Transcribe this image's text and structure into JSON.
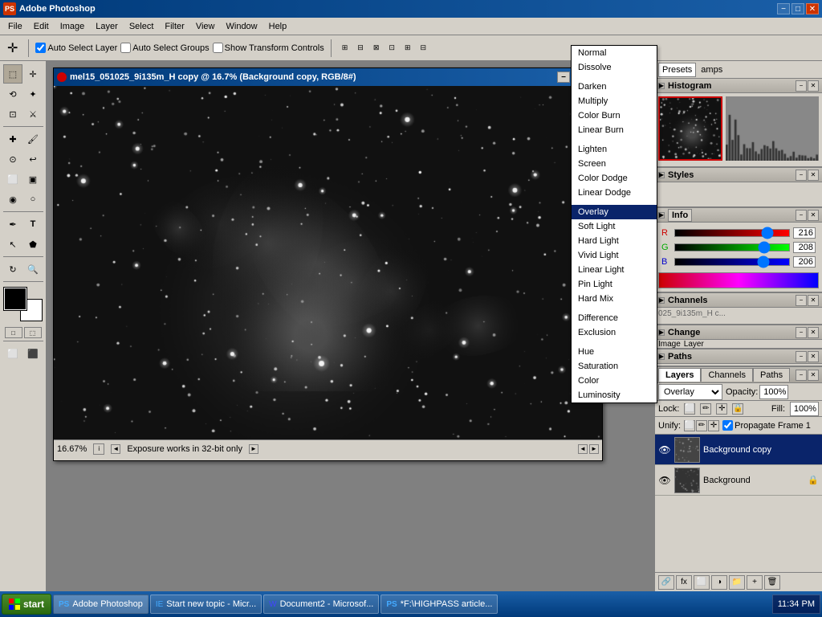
{
  "app": {
    "title": "Adobe Photoshop",
    "icon": "PS"
  },
  "titlebar": {
    "title": "Adobe Photoshop",
    "minimize": "−",
    "maximize": "□",
    "close": "✕"
  },
  "menubar": {
    "items": [
      "File",
      "Edit",
      "Image",
      "Layer",
      "Select",
      "Filter",
      "View",
      "Window",
      "Help"
    ]
  },
  "toolbar": {
    "select_label": "Select",
    "auto_select_layer": "Auto Select Layer",
    "auto_select_groups": "Auto Select Groups",
    "show_transform": "Show Transform Controls"
  },
  "document": {
    "title": "mel15_051025_9i135m_H copy @ 16.7% (Background copy, RGB/8#)",
    "zoom": "16.67%",
    "status": "Exposure works in 32-bit only"
  },
  "blend_modes": {
    "current": "Overlay",
    "groups": [
      {
        "items": [
          "Normal",
          "Dissolve"
        ]
      },
      {
        "items": [
          "Darken",
          "Multiply",
          "Color Burn",
          "Linear Burn"
        ]
      },
      {
        "items": [
          "Lighten",
          "Screen",
          "Color Dodge",
          "Linear Dodge"
        ]
      },
      {
        "items": [
          "Overlay",
          "Soft Light",
          "Hard Light",
          "Vivid Light",
          "Linear Light",
          "Pin Light",
          "Hard Mix"
        ]
      },
      {
        "items": [
          "Difference",
          "Exclusion"
        ]
      },
      {
        "items": [
          "Hue",
          "Saturation",
          "Color",
          "Luminosity"
        ]
      }
    ]
  },
  "panels": {
    "histogram_title": "Histogram",
    "styles_title": "Styles",
    "channels_title": "Channels",
    "paths_title": "Paths",
    "channels": {
      "sliders": [
        {
          "label": "R",
          "value": 216,
          "color": "r"
        },
        {
          "label": "G",
          "value": 208,
          "color": "g"
        },
        {
          "label": "B",
          "value": 206,
          "color": "b"
        }
      ]
    },
    "info_panel_title": "Info"
  },
  "layers": {
    "title": "Layers",
    "tabs": [
      "Layers",
      "Channels",
      "Paths"
    ],
    "active_tab": "Layers",
    "blend_mode": "Overlay",
    "opacity": "100%",
    "fill": "100%",
    "lock_label": "Lock:",
    "unify_label": "Unify:",
    "propagate_label": "Propagate Frame 1",
    "items": [
      {
        "name": "Background copy",
        "visible": true,
        "active": true,
        "locked": false
      },
      {
        "name": "Background",
        "visible": true,
        "active": false,
        "locked": true
      }
    ]
  },
  "taskbar": {
    "start": "start",
    "items": [
      {
        "label": "Adobe Photoshop",
        "active": true,
        "icon": "PS"
      },
      {
        "label": "Start new topic - Micr...",
        "active": false,
        "icon": "IE"
      },
      {
        "label": "Document2 - Microsof...",
        "active": false,
        "icon": "W"
      },
      {
        "label": "*F:\\HIGHPASS article...",
        "active": false,
        "icon": "PS"
      }
    ],
    "clock": "11:34 PM"
  },
  "scrollbar": {
    "up": "▲",
    "down": "▼",
    "left": "◄",
    "right": "►"
  }
}
